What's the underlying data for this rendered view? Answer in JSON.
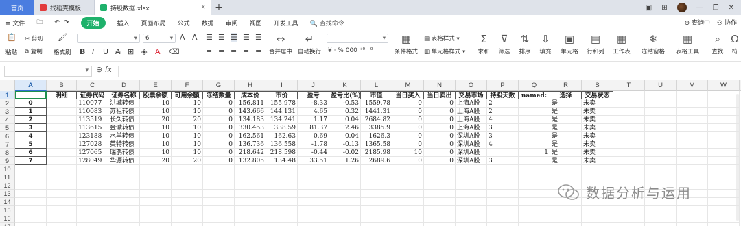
{
  "window": {
    "tabs": [
      {
        "label": "首页"
      },
      {
        "label": "找稻壳模板"
      },
      {
        "label": "持股数据.xlsx"
      }
    ],
    "new_tab": "+"
  },
  "menu": {
    "file": "≡ 文件",
    "items": [
      "开始",
      "插入",
      "页面布局",
      "公式",
      "数据",
      "审阅",
      "视图",
      "开发工具"
    ],
    "active": "开始",
    "search": "查找命令",
    "right": [
      "查询中",
      "协作"
    ]
  },
  "ribbon": {
    "paste": "粘贴",
    "cut": "剪切",
    "copy": "复制",
    "format_painter": "格式刷",
    "font_size": "6",
    "merge": "合并居中",
    "wrap": "自动换行",
    "number_symbols": "¥ · % 000 ⁺⁰ ⁻⁰",
    "cond_format": "条件格式",
    "table_style": "表格样式",
    "cell_style": "单元格样式",
    "sum": "求和",
    "filter": "筛选",
    "sort": "排序",
    "fill": "填充",
    "cell": "单元格",
    "row_col": "行和列",
    "worksheet": "工作表",
    "freeze": "冻结窗格",
    "table_tools": "表格工具",
    "find": "查找",
    "symbol": "符"
  },
  "formula_bar": {
    "name_box": "",
    "fx": "fx",
    "value": ""
  },
  "sheet": {
    "columns": [
      "A",
      "B",
      "C",
      "D",
      "E",
      "F",
      "G",
      "H",
      "I",
      "J",
      "K",
      "L",
      "M",
      "N",
      "O",
      "P",
      "Q",
      "R",
      "S",
      "T",
      "U",
      "V",
      "W"
    ],
    "selected_column": "A",
    "rows": [
      "1",
      "2",
      "3",
      "4",
      "5",
      "6",
      "7",
      "8",
      "9",
      "10",
      "11",
      "12",
      "13",
      "14",
      "15",
      "16",
      "17"
    ],
    "header": [
      "",
      "明细",
      "证券代码",
      "证券名称",
      "股票余额",
      "可用余额",
      "冻结数量",
      "成本价",
      "市价",
      "盈亏",
      "盈亏比(%)",
      "市值",
      "当日买入",
      "当日卖出",
      "交易市场",
      "持股天数",
      "named:",
      "选择",
      "交易状态"
    ],
    "data": [
      [
        "0",
        "",
        "110077",
        "洪城转债",
        "10",
        "10",
        "0",
        "156.811",
        "155.978",
        "-8.33",
        "-0.53",
        "1559.78",
        "0",
        "0",
        "上海A股",
        "2",
        "",
        "是",
        "未卖"
      ],
      [
        "1",
        "",
        "110083",
        "苏租转债",
        "10",
        "10",
        "0",
        "143.666",
        "144.131",
        "4.65",
        "0.32",
        "1441.31",
        "0",
        "0",
        "上海A股",
        "2",
        "",
        "是",
        "未卖"
      ],
      [
        "2",
        "",
        "113519",
        "长久转债",
        "20",
        "20",
        "0",
        "134.183",
        "134.241",
        "1.17",
        "0.04",
        "2684.82",
        "0",
        "0",
        "上海A股",
        "4",
        "",
        "是",
        "未卖"
      ],
      [
        "3",
        "",
        "113615",
        "金诚转债",
        "10",
        "10",
        "0",
        "330.453",
        "338.59",
        "81.37",
        "2.46",
        "3385.9",
        "0",
        "0",
        "上海A股",
        "3",
        "",
        "是",
        "未卖"
      ],
      [
        "4",
        "",
        "123188",
        "水羊转债",
        "10",
        "10",
        "0",
        "162.561",
        "162.63",
        "0.69",
        "0.04",
        "1626.3",
        "0",
        "0",
        "深圳A股",
        "3",
        "",
        "是",
        "未卖"
      ],
      [
        "5",
        "",
        "127028",
        "英特转债",
        "10",
        "10",
        "0",
        "136.736",
        "136.558",
        "-1.78",
        "-0.13",
        "1365.58",
        "0",
        "0",
        "深圳A股",
        "4",
        "",
        "是",
        "未卖"
      ],
      [
        "6",
        "",
        "127065",
        "瑞鹊转债",
        "10",
        "10",
        "0",
        "218.642",
        "218.598",
        "-0.44",
        "-0.02",
        "2185.98",
        "10",
        "0",
        "深圳A股",
        "",
        "1",
        "是",
        "未卖"
      ],
      [
        "7",
        "",
        "128049",
        "华源转债",
        "20",
        "20",
        "0",
        "132.805",
        "134.48",
        "33.51",
        "1.26",
        "2689.6",
        "0",
        "0",
        "深圳A股",
        "3",
        "",
        "是",
        "未卖"
      ]
    ]
  },
  "watermark": "数据分析与运用"
}
